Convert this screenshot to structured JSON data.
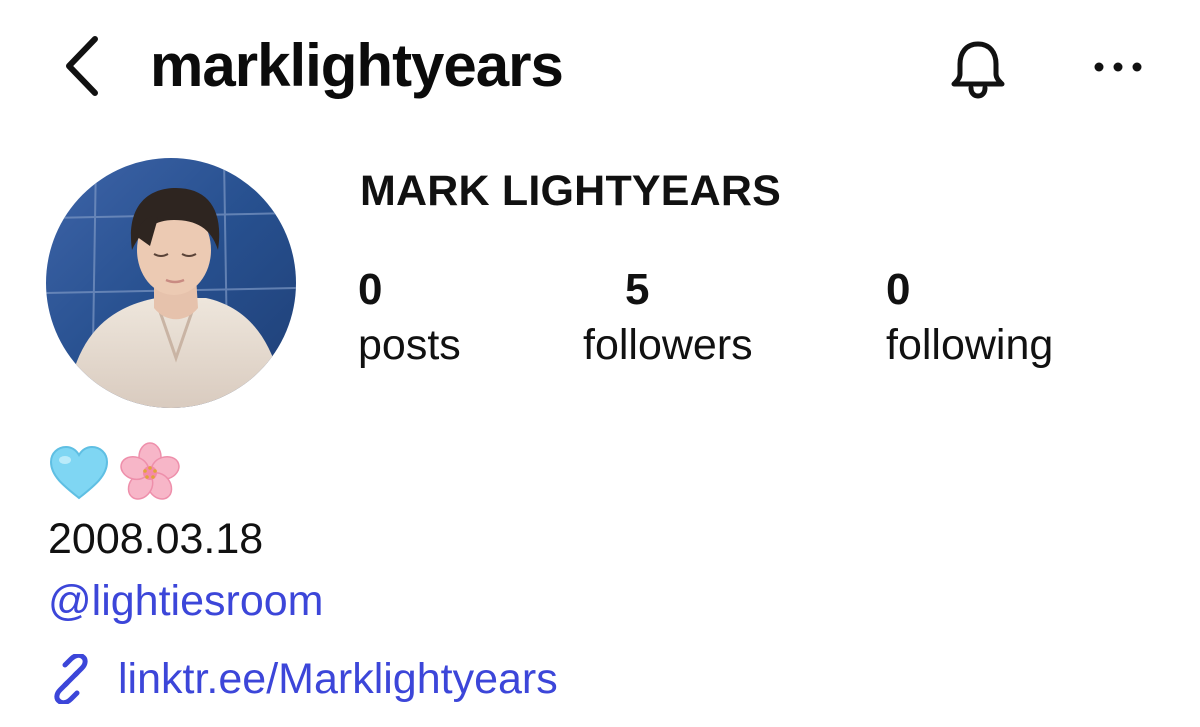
{
  "header": {
    "username": "marklightyears",
    "icons": {
      "back": "chevron-left-icon",
      "notifications": "bell-icon",
      "more": "more-horizontal-icon"
    }
  },
  "profile": {
    "display_name": "MARK LIGHTYEARS",
    "avatar": "profile-photo"
  },
  "stats": [
    {
      "count": "0",
      "label": "posts"
    },
    {
      "count": "5",
      "label": "followers"
    },
    {
      "count": "0",
      "label": "following"
    }
  ],
  "bio": {
    "emojis": [
      "🩵",
      "🌸"
    ],
    "date": "2008.03.18",
    "mention": "@lightiesroom",
    "link": "linktr.ee/Marklightyears"
  },
  "colors": {
    "link": "#3c46d9",
    "text": "#111111",
    "background": "#ffffff"
  }
}
